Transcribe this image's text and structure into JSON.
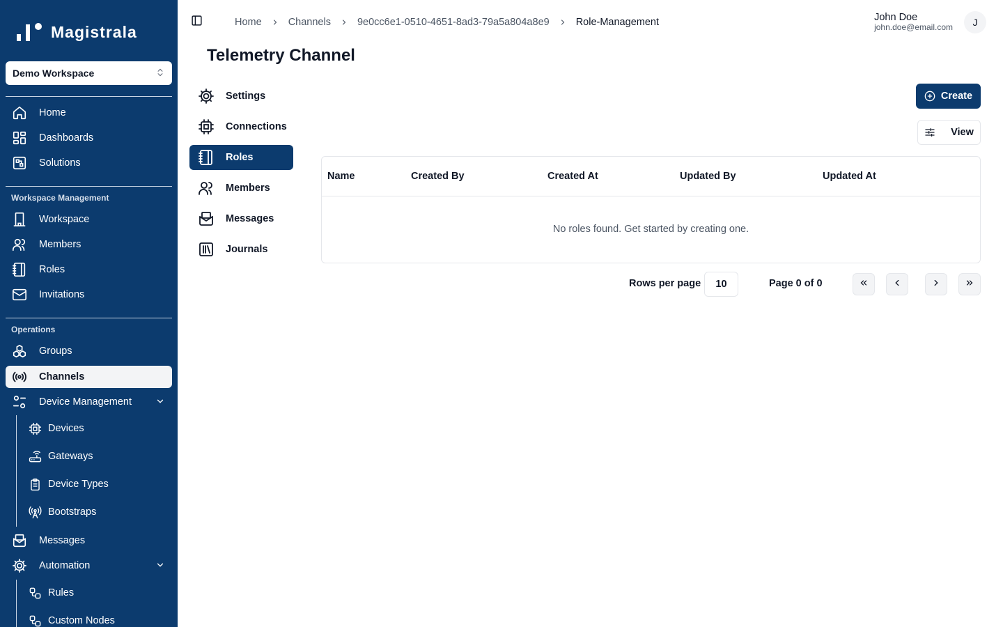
{
  "app": {
    "logo_text": "Magistrala",
    "workspace": "Demo Workspace"
  },
  "sidebar": {
    "main_items": [
      {
        "label": "Home",
        "icon": "home-icon"
      },
      {
        "label": "Dashboards",
        "icon": "dashboard-icon"
      },
      {
        "label": "Solutions",
        "icon": "solutions-icon"
      }
    ],
    "workspace_section": {
      "label": "Workspace Management",
      "items": [
        {
          "label": "Workspace",
          "icon": "building-icon"
        },
        {
          "label": "Members",
          "icon": "users-icon"
        },
        {
          "label": "Roles",
          "icon": "notebook-icon"
        },
        {
          "label": "Invitations",
          "icon": "mail-icon"
        }
      ]
    },
    "operations_section": {
      "label": "Operations",
      "items": [
        {
          "label": "Groups",
          "icon": "boxes-icon"
        },
        {
          "label": "Channels",
          "icon": "radio-icon",
          "active": true
        },
        {
          "label": "Device Management",
          "icon": "settings-sliders-icon"
        }
      ],
      "device_subitems": [
        {
          "label": "Devices",
          "icon": "cpu-icon"
        },
        {
          "label": "Gateways",
          "icon": "router-icon"
        },
        {
          "label": "Device Types",
          "icon": "clipboard-icon"
        },
        {
          "label": "Bootstraps",
          "icon": "antenna-icon"
        }
      ],
      "after_items": [
        {
          "label": "Messages",
          "icon": "mail-open-icon"
        },
        {
          "label": "Automation",
          "icon": "gear-icon"
        }
      ],
      "automation_subitems": [
        {
          "label": "Rules",
          "icon": "workflow-icon"
        },
        {
          "label": "Custom Nodes",
          "icon": "workflow-icon"
        }
      ]
    }
  },
  "header": {
    "breadcrumb": [
      "Home",
      "Channels",
      "9e0cc6e1-0510-4651-8ad3-79a5a804a8e9",
      "Role-Management"
    ],
    "user_name": "John Doe",
    "user_email": "john.doe@email.com",
    "avatar_initial": "J"
  },
  "page": {
    "title": "Telemetry Channel",
    "tabs": [
      {
        "label": "Settings",
        "icon": "gear-icon"
      },
      {
        "label": "Connections",
        "icon": "cpu-icon"
      },
      {
        "label": "Roles",
        "icon": "notebook-icon",
        "active": true
      },
      {
        "label": "Members",
        "icon": "users-icon"
      },
      {
        "label": "Messages",
        "icon": "mail-open-icon"
      },
      {
        "label": "Journals",
        "icon": "library-icon"
      }
    ],
    "create_label": "Create",
    "view_label": "View"
  },
  "table": {
    "columns": [
      "Name",
      "Created By",
      "Created At",
      "Updated By",
      "Updated At"
    ],
    "empty_message": "No roles found. Get started by creating one."
  },
  "pagination": {
    "rows_per_page_label": "Rows per page",
    "rows_per_page": "10",
    "page_info": "Page 0 of 0"
  },
  "colors": {
    "primary": "#0c3b6e",
    "muted_bg": "#f3f4f6",
    "border": "#e5e7eb"
  }
}
